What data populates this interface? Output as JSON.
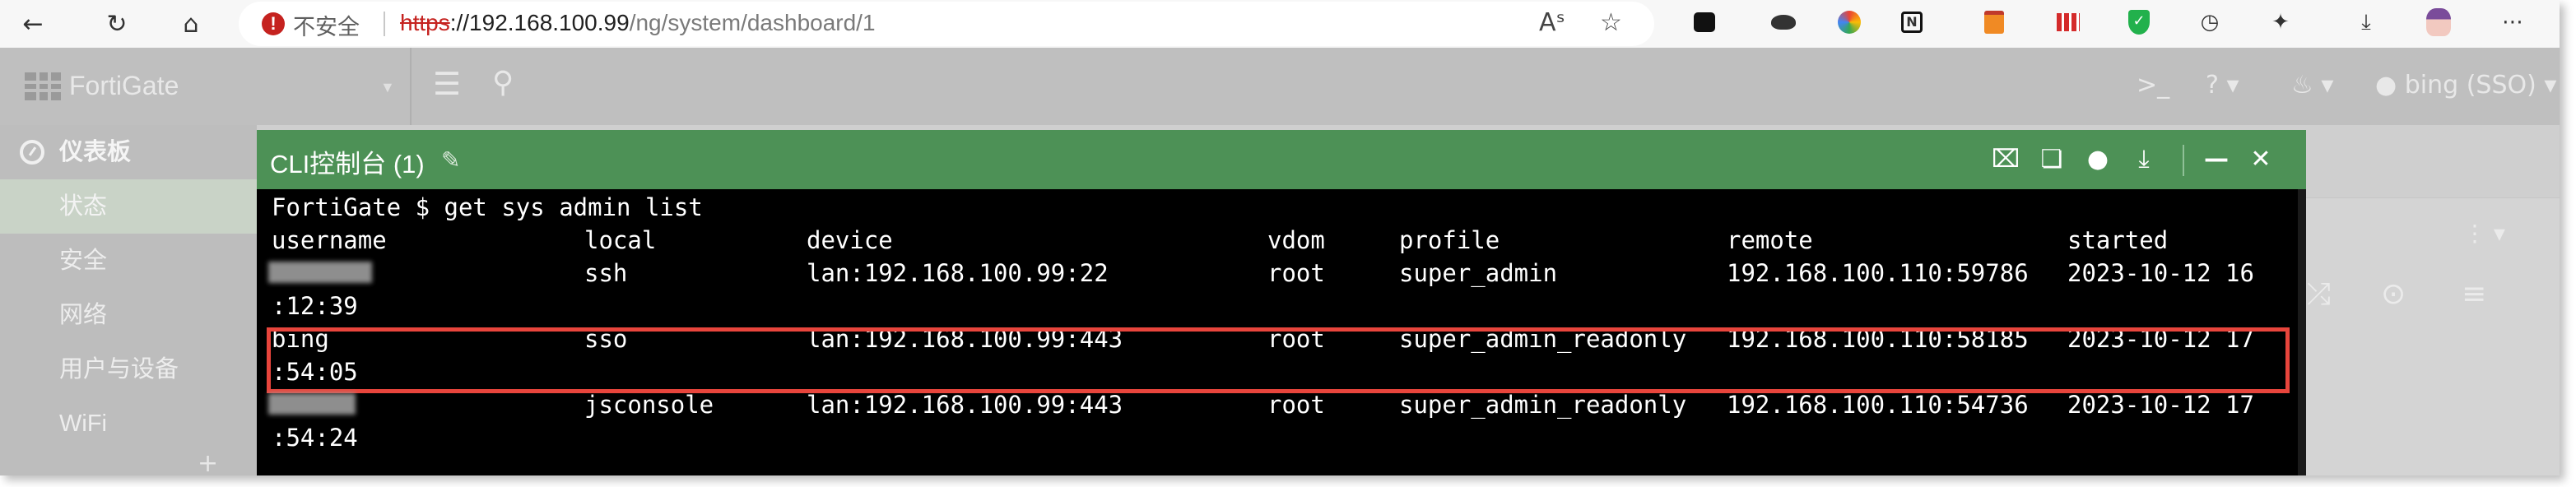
{
  "browser": {
    "insecure_label": "不安全",
    "url_scheme": "https",
    "url_sep": "://",
    "url_host": "192.168.100.99",
    "url_path": "/ng/system/dashboard/1",
    "reader_label": "Aˢ"
  },
  "fortigate": {
    "title": "FortiGate",
    "user_label": "bing (SSO)"
  },
  "sidebar": {
    "items": [
      {
        "label": "仪表板"
      },
      {
        "label": "状态"
      },
      {
        "label": "安全"
      },
      {
        "label": "网络"
      },
      {
        "label": "用户与设备"
      },
      {
        "label": "WiFi"
      }
    ]
  },
  "cli": {
    "title": "CLI控制台 (1)",
    "command": "FortiGate $ get sys admin list",
    "columns": [
      "username",
      "local",
      "device",
      "vdom",
      "profile",
      "remote",
      "started"
    ],
    "rows": [
      {
        "username": "",
        "local": "ssh",
        "device": "lan:192.168.100.99:22",
        "vdom": "root",
        "profile": "super_admin",
        "remote": "192.168.100.110:59786",
        "started": "2023-10-12 16",
        "cont": ":12:39"
      },
      {
        "username": "bing",
        "local": "sso",
        "device": "lan:192.168.100.99:443",
        "vdom": "root",
        "profile": "super_admin_readonly",
        "remote": "192.168.100.110:58185",
        "started": "2023-10-12 17",
        "cont": ":54:05"
      },
      {
        "username": "",
        "local": "jsconsole",
        "device": "lan:192.168.100.99:443",
        "vdom": "root",
        "profile": "super_admin_readonly",
        "remote": "192.168.100.110:54736",
        "started": "2023-10-12 17",
        "cont": ":54:24"
      }
    ],
    "highlighted_row": 1
  },
  "colors": {
    "cli_header": "#4d9156",
    "cli_background": "#000000",
    "highlight_border": "#e8453c",
    "insecure_red": "#c5221f"
  }
}
